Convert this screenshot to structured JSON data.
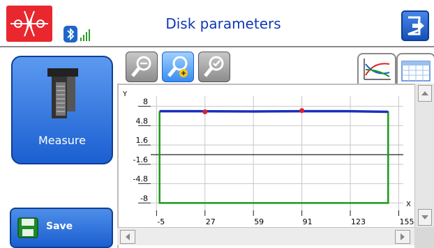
{
  "header": {
    "title": "Disk parameters",
    "logo_icon": "laser-alignment-logo-icon",
    "bluetooth_icon": "bluetooth-icon",
    "signal_icon": "signal-strength-icon",
    "exit_icon": "exit-icon"
  },
  "left_panel": {
    "measure_label": "Measure",
    "measure_icon": "measurement-unit-icon",
    "save_label": "Save",
    "save_icon": "floppy-disk-icon"
  },
  "toolbar": {
    "zoom_out_icon": "zoom-out-icon",
    "zoom_in_icon": "zoom-in-icon",
    "zoom_reset_icon": "zoom-reset-icon",
    "graph_tab_icon": "graph-view-icon",
    "table_tab_icon": "table-view-icon",
    "active_tab": "graph"
  },
  "colors": {
    "accent": "#1b5fd1",
    "title": "#0f37b5",
    "logo": "#e8282e",
    "series_blue": "#1a2fbf",
    "series_green": "#1a9a1a",
    "marker": "#e0202a"
  },
  "chart_data": {
    "type": "line",
    "xlabel": "X",
    "ylabel": "Y",
    "x_ticks": [
      -5,
      27,
      59,
      91,
      123,
      155
    ],
    "x_tick_labels": [
      "-5",
      "27",
      "59",
      "91",
      "123",
      "155"
    ],
    "y_ticks": [
      8,
      4.8,
      1.6,
      -1.6,
      -4.8,
      -8
    ],
    "y_tick_labels": [
      "8",
      "4.8",
      "1.6",
      "-1.6",
      "-4.8",
      "-8"
    ],
    "xlim": [
      -7,
      158
    ],
    "ylim": [
      -9,
      9
    ],
    "grid": true,
    "series": [
      {
        "color": "#1a9a1a",
        "x": [
          -3,
          -3,
          148,
          148
        ],
        "y": [
          7.2,
          -8,
          -8,
          7.2
        ]
      },
      {
        "color": "#1a2fbf",
        "x": [
          -3,
          20,
          60,
          91,
          120,
          148
        ],
        "y": [
          7.2,
          7.2,
          7.15,
          7.2,
          7.2,
          7.1
        ]
      }
    ],
    "markers": {
      "color": "#e0202a",
      "x": [
        27,
        91
      ],
      "y": [
        7.1,
        7.3
      ]
    }
  }
}
